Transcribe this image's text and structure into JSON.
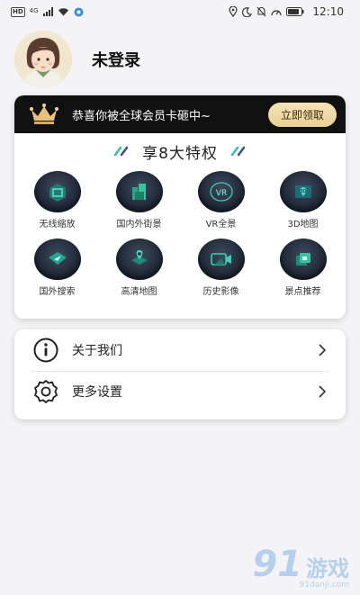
{
  "status_bar": {
    "network_badge": "HD",
    "signal_type": "4G",
    "time": "12:10"
  },
  "profile": {
    "name": "未登录"
  },
  "member": {
    "banner_text": "恭喜你被全球会员卡砸中~",
    "claim_label": "立即领取",
    "privilege_title": "享8大特权",
    "features": [
      {
        "label": "无线缩放",
        "icon": "zoom-icon"
      },
      {
        "label": "国内外街景",
        "icon": "street-view-icon"
      },
      {
        "label": "VR全景",
        "icon": "vr-icon"
      },
      {
        "label": "3D地图",
        "icon": "3d-map-icon"
      },
      {
        "label": "国外搜索",
        "icon": "search-abroad-icon"
      },
      {
        "label": "高清地图",
        "icon": "hd-map-icon"
      },
      {
        "label": "历史影像",
        "icon": "history-image-icon"
      },
      {
        "label": "景点推荐",
        "icon": "attraction-icon"
      }
    ]
  },
  "menu": {
    "about_label": "关于我们",
    "settings_label": "更多设置"
  },
  "watermark": {
    "number": "91",
    "text": "游戏",
    "url": "91danji.com"
  },
  "colors": {
    "banner_bg": "#111111",
    "gold": "#e9cf95",
    "feature_icon": "#1c2432",
    "accent_teal": "#2ec4a4"
  }
}
